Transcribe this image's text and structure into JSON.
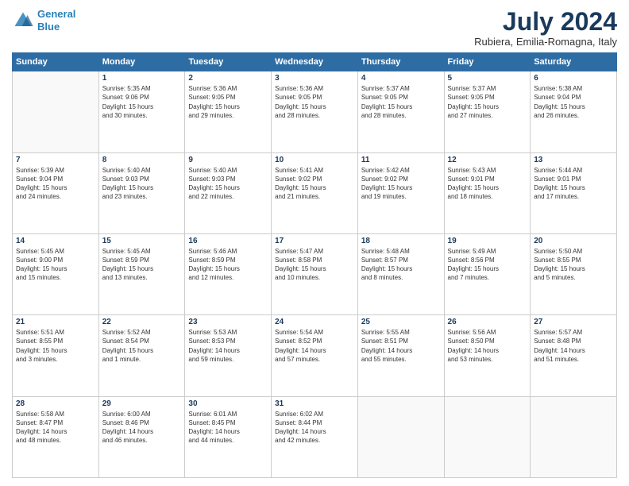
{
  "header": {
    "logo_line1": "General",
    "logo_line2": "Blue",
    "main_title": "July 2024",
    "subtitle": "Rubiera, Emilia-Romagna, Italy"
  },
  "weekdays": [
    "Sunday",
    "Monday",
    "Tuesday",
    "Wednesday",
    "Thursday",
    "Friday",
    "Saturday"
  ],
  "weeks": [
    [
      {
        "day": "",
        "info": ""
      },
      {
        "day": "1",
        "info": "Sunrise: 5:35 AM\nSunset: 9:06 PM\nDaylight: 15 hours\nand 30 minutes."
      },
      {
        "day": "2",
        "info": "Sunrise: 5:36 AM\nSunset: 9:05 PM\nDaylight: 15 hours\nand 29 minutes."
      },
      {
        "day": "3",
        "info": "Sunrise: 5:36 AM\nSunset: 9:05 PM\nDaylight: 15 hours\nand 28 minutes."
      },
      {
        "day": "4",
        "info": "Sunrise: 5:37 AM\nSunset: 9:05 PM\nDaylight: 15 hours\nand 28 minutes."
      },
      {
        "day": "5",
        "info": "Sunrise: 5:37 AM\nSunset: 9:05 PM\nDaylight: 15 hours\nand 27 minutes."
      },
      {
        "day": "6",
        "info": "Sunrise: 5:38 AM\nSunset: 9:04 PM\nDaylight: 15 hours\nand 26 minutes."
      }
    ],
    [
      {
        "day": "7",
        "info": "Sunrise: 5:39 AM\nSunset: 9:04 PM\nDaylight: 15 hours\nand 24 minutes."
      },
      {
        "day": "8",
        "info": "Sunrise: 5:40 AM\nSunset: 9:03 PM\nDaylight: 15 hours\nand 23 minutes."
      },
      {
        "day": "9",
        "info": "Sunrise: 5:40 AM\nSunset: 9:03 PM\nDaylight: 15 hours\nand 22 minutes."
      },
      {
        "day": "10",
        "info": "Sunrise: 5:41 AM\nSunset: 9:02 PM\nDaylight: 15 hours\nand 21 minutes."
      },
      {
        "day": "11",
        "info": "Sunrise: 5:42 AM\nSunset: 9:02 PM\nDaylight: 15 hours\nand 19 minutes."
      },
      {
        "day": "12",
        "info": "Sunrise: 5:43 AM\nSunset: 9:01 PM\nDaylight: 15 hours\nand 18 minutes."
      },
      {
        "day": "13",
        "info": "Sunrise: 5:44 AM\nSunset: 9:01 PM\nDaylight: 15 hours\nand 17 minutes."
      }
    ],
    [
      {
        "day": "14",
        "info": "Sunrise: 5:45 AM\nSunset: 9:00 PM\nDaylight: 15 hours\nand 15 minutes."
      },
      {
        "day": "15",
        "info": "Sunrise: 5:45 AM\nSunset: 8:59 PM\nDaylight: 15 hours\nand 13 minutes."
      },
      {
        "day": "16",
        "info": "Sunrise: 5:46 AM\nSunset: 8:59 PM\nDaylight: 15 hours\nand 12 minutes."
      },
      {
        "day": "17",
        "info": "Sunrise: 5:47 AM\nSunset: 8:58 PM\nDaylight: 15 hours\nand 10 minutes."
      },
      {
        "day": "18",
        "info": "Sunrise: 5:48 AM\nSunset: 8:57 PM\nDaylight: 15 hours\nand 8 minutes."
      },
      {
        "day": "19",
        "info": "Sunrise: 5:49 AM\nSunset: 8:56 PM\nDaylight: 15 hours\nand 7 minutes."
      },
      {
        "day": "20",
        "info": "Sunrise: 5:50 AM\nSunset: 8:55 PM\nDaylight: 15 hours\nand 5 minutes."
      }
    ],
    [
      {
        "day": "21",
        "info": "Sunrise: 5:51 AM\nSunset: 8:55 PM\nDaylight: 15 hours\nand 3 minutes."
      },
      {
        "day": "22",
        "info": "Sunrise: 5:52 AM\nSunset: 8:54 PM\nDaylight: 15 hours\nand 1 minute."
      },
      {
        "day": "23",
        "info": "Sunrise: 5:53 AM\nSunset: 8:53 PM\nDaylight: 14 hours\nand 59 minutes."
      },
      {
        "day": "24",
        "info": "Sunrise: 5:54 AM\nSunset: 8:52 PM\nDaylight: 14 hours\nand 57 minutes."
      },
      {
        "day": "25",
        "info": "Sunrise: 5:55 AM\nSunset: 8:51 PM\nDaylight: 14 hours\nand 55 minutes."
      },
      {
        "day": "26",
        "info": "Sunrise: 5:56 AM\nSunset: 8:50 PM\nDaylight: 14 hours\nand 53 minutes."
      },
      {
        "day": "27",
        "info": "Sunrise: 5:57 AM\nSunset: 8:48 PM\nDaylight: 14 hours\nand 51 minutes."
      }
    ],
    [
      {
        "day": "28",
        "info": "Sunrise: 5:58 AM\nSunset: 8:47 PM\nDaylight: 14 hours\nand 48 minutes."
      },
      {
        "day": "29",
        "info": "Sunrise: 6:00 AM\nSunset: 8:46 PM\nDaylight: 14 hours\nand 46 minutes."
      },
      {
        "day": "30",
        "info": "Sunrise: 6:01 AM\nSunset: 8:45 PM\nDaylight: 14 hours\nand 44 minutes."
      },
      {
        "day": "31",
        "info": "Sunrise: 6:02 AM\nSunset: 8:44 PM\nDaylight: 14 hours\nand 42 minutes."
      },
      {
        "day": "",
        "info": ""
      },
      {
        "day": "",
        "info": ""
      },
      {
        "day": "",
        "info": ""
      }
    ]
  ]
}
